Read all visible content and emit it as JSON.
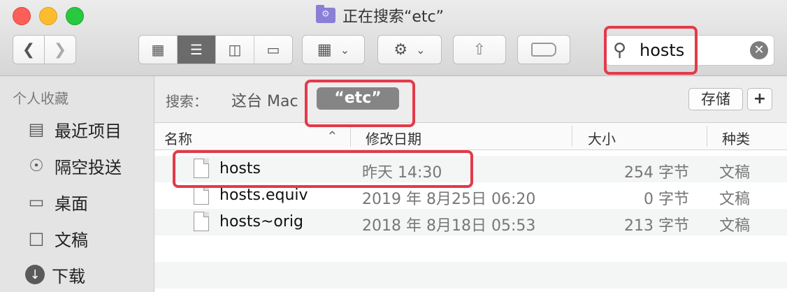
{
  "window": {
    "title": "正在搜索“etc”"
  },
  "toolbar": {
    "back_icon": "chevron-left-icon",
    "forward_icon": "chevron-right-icon",
    "view_icons": [
      "icon-view-icon",
      "list-view-icon",
      "column-view-icon",
      "gallery-view-icon"
    ],
    "active_view": "list-view-icon",
    "group_icon": "group-by-icon",
    "action_icon": "gear-icon",
    "share_icon": "share-icon",
    "tag_icon": "tag-icon"
  },
  "search": {
    "value": "hosts",
    "icon": "search-icon",
    "clear_icon": "clear-icon"
  },
  "sidebar": {
    "heading": "个人收藏",
    "items": [
      {
        "label": "最近项目",
        "icon": "recents-icon"
      },
      {
        "label": "隔空投送",
        "icon": "airdrop-icon"
      },
      {
        "label": "桌面",
        "icon": "desktop-icon"
      },
      {
        "label": "文稿",
        "icon": "documents-icon"
      },
      {
        "label": "下载",
        "icon": "downloads-icon"
      }
    ]
  },
  "scope": {
    "label": "搜索：",
    "this_mac": "这台 Mac",
    "folder": "“etc”",
    "save": "存储",
    "add": "+"
  },
  "columns": {
    "name": "名称",
    "date": "修改日期",
    "size": "大小",
    "kind": "种类"
  },
  "files": [
    {
      "name": "hosts",
      "date": "昨天 14:30",
      "size": "254 字节",
      "kind": "文稿"
    },
    {
      "name": "hosts.equiv",
      "date": "2019 年 8月25日 06:20",
      "size": "0 字节",
      "kind": "文稿"
    },
    {
      "name": "hosts~orig",
      "date": "2018 年 8月18日 05:53",
      "size": "213 字节",
      "kind": "文稿"
    }
  ],
  "colors": {
    "highlight": "#e33a4a",
    "active_view": "#6b6b6b",
    "scope_selected": "#858585"
  }
}
